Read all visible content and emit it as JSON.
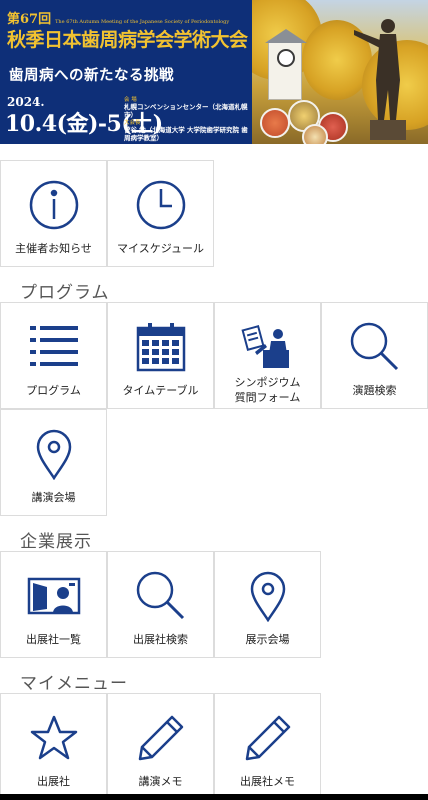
{
  "banner": {
    "subtitle": "第67回",
    "subtitle_en": "The 67th Autumn Meeting of the Japanese Society of Periodontology",
    "title": "秋季日本歯周病学会学術大会",
    "theme": "歯周病への新たなる挑戦",
    "year": "2024.",
    "dates": "10.4(金)-5(土)",
    "venue_tag": "会 場",
    "venue": "札幌コンベンションセンター（北海道札幌市）",
    "chair_tag": "大会長",
    "chair": "菅谷 勉（北海道大学 大学院歯学研究院 歯周病学教室）"
  },
  "top_menu": [
    {
      "label": "主催者お知らせ",
      "icon": "info-icon"
    },
    {
      "label": "マイスケジュール",
      "icon": "clock-icon"
    }
  ],
  "sections": {
    "program": "プログラム",
    "exhibition": "企業展示",
    "mymenu": "マイメニュー"
  },
  "program_menu": [
    {
      "label": "プログラム",
      "icon": "list-icon"
    },
    {
      "label": "タイムテーブル",
      "icon": "calendar-icon"
    },
    {
      "label": "シンポジウム\n質問フォーム",
      "icon": "speaker-podium-icon"
    },
    {
      "label": "演題検索",
      "icon": "search-icon"
    },
    {
      "label": "講演会場",
      "icon": "map-pin-icon"
    }
  ],
  "exhibition_menu": [
    {
      "label": "出展社一覧",
      "icon": "exhibitor-booth-icon"
    },
    {
      "label": "出展社検索",
      "icon": "search-icon"
    },
    {
      "label": "展示会場",
      "icon": "map-pin-icon"
    }
  ],
  "my_menu": [
    {
      "label": "出展社",
      "icon": "star-icon"
    },
    {
      "label": "講演メモ",
      "icon": "pencil-icon"
    },
    {
      "label": "出展社メモ",
      "icon": "pencil-icon"
    }
  ],
  "colors": {
    "icon": "#1b3f8b",
    "banner_bg": "#0e2f78",
    "banner_gold": "#f2c230"
  }
}
